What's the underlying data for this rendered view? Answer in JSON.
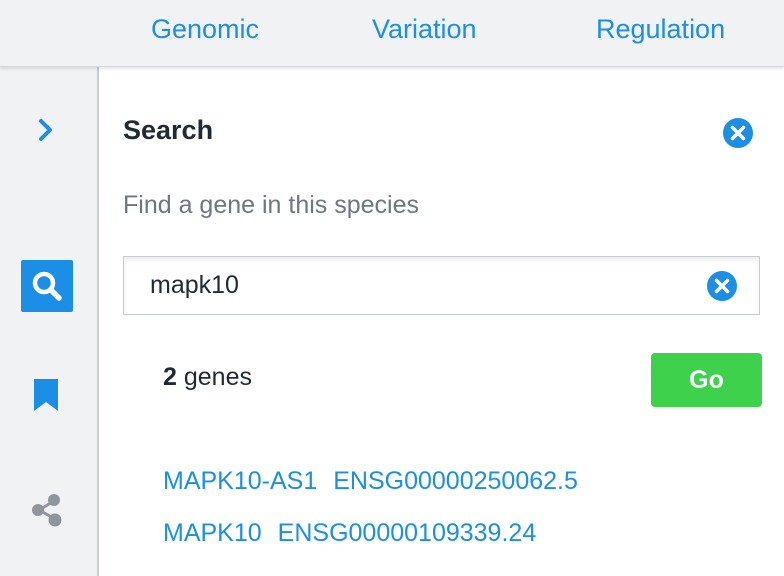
{
  "tabs": [
    {
      "label": "Genomic"
    },
    {
      "label": "Variation"
    },
    {
      "label": "Regulation"
    }
  ],
  "sidebar": {
    "items": [
      {
        "icon": "chevron-right-icon"
      },
      {
        "icon": "search-icon",
        "active": true
      },
      {
        "icon": "bookmark-icon"
      },
      {
        "icon": "share-icon"
      }
    ]
  },
  "panel": {
    "title": "Search",
    "subtitle": "Find a gene in this species",
    "search": {
      "value": "mapk10",
      "placeholder": ""
    },
    "results": {
      "count": "2",
      "count_label": "genes",
      "go_label": "Go",
      "items": [
        {
          "symbol": "MAPK10-AS1",
          "id": "ENSG00000250062.5"
        },
        {
          "symbol": "MAPK10",
          "id": "ENSG00000109339.24"
        }
      ]
    }
  },
  "colors": {
    "accent": "#1b8fe6",
    "go_button": "#3ed14c",
    "sidebar_bg": "#f1f2f4",
    "text_dark": "#1f2a36",
    "text_muted": "#6d7781"
  }
}
